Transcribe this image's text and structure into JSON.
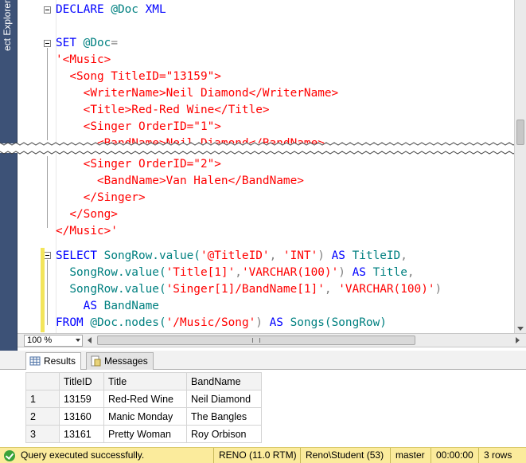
{
  "explorer": {
    "label": "ect Explorer"
  },
  "editor": {
    "lines": [
      [
        {
          "t": "DECLARE ",
          "c": "kw"
        },
        {
          "t": "@Doc ",
          "c": "fn"
        },
        {
          "t": "XML",
          "c": "kw"
        }
      ],
      [],
      [
        {
          "t": "SET ",
          "c": "kw"
        },
        {
          "t": "@Doc",
          "c": "fn"
        },
        {
          "t": "=",
          "c": "gray"
        }
      ],
      [
        {
          "t": "'<Music>",
          "c": "str"
        }
      ],
      [
        {
          "t": "  <Song TitleID=\"13159\">",
          "c": "str"
        }
      ],
      [
        {
          "t": "    <WriterName>Neil Diamond</WriterName>",
          "c": "str"
        }
      ],
      [
        {
          "t": "    <Title>Red-Red Wine</Title>",
          "c": "str"
        }
      ],
      [
        {
          "t": "    <Singer OrderID=\"1\">",
          "c": "str"
        }
      ],
      [
        {
          "t": "      <BandName>Neil Diamond</BandName>",
          "c": "str"
        }
      ],
      [
        {
          "t": "    <Singer OrderID=\"2\">",
          "c": "str"
        }
      ],
      [
        {
          "t": "      <BandName>Van Halen</BandName>",
          "c": "str"
        }
      ],
      [
        {
          "t": "    </Singer>",
          "c": "str"
        }
      ],
      [
        {
          "t": "  </Song>",
          "c": "str"
        }
      ],
      [
        {
          "t": "</Music>'",
          "c": "str"
        }
      ],
      [],
      [
        {
          "t": "SELECT ",
          "c": "kw"
        },
        {
          "t": "SongRow.value(",
          "c": "fn"
        },
        {
          "t": "'@TitleID'",
          "c": "str"
        },
        {
          "t": ", ",
          "c": "gray"
        },
        {
          "t": "'INT'",
          "c": "str"
        },
        {
          "t": ") ",
          "c": "gray"
        },
        {
          "t": "AS ",
          "c": "kw"
        },
        {
          "t": "TitleID",
          "c": "fn"
        },
        {
          "t": ",",
          "c": "gray"
        }
      ],
      [
        {
          "t": "  SongRow.value(",
          "c": "fn"
        },
        {
          "t": "'Title[1]'",
          "c": "str"
        },
        {
          "t": ",",
          "c": "gray"
        },
        {
          "t": "'VARCHAR(100)'",
          "c": "str"
        },
        {
          "t": ") ",
          "c": "gray"
        },
        {
          "t": "AS ",
          "c": "kw"
        },
        {
          "t": "Title",
          "c": "fn"
        },
        {
          "t": ",",
          "c": "gray"
        }
      ],
      [
        {
          "t": "  SongRow.value(",
          "c": "fn"
        },
        {
          "t": "'Singer[1]/BandName[1]'",
          "c": "str"
        },
        {
          "t": ", ",
          "c": "gray"
        },
        {
          "t": "'VARCHAR(100)'",
          "c": "str"
        },
        {
          "t": ")",
          "c": "gray"
        }
      ],
      [
        {
          "t": "    AS ",
          "c": "kw"
        },
        {
          "t": "BandName",
          "c": "fn"
        }
      ],
      [
        {
          "t": "FROM ",
          "c": "kw"
        },
        {
          "t": "@Doc.nodes(",
          "c": "fn"
        },
        {
          "t": "'/Music/Song'",
          "c": "str"
        },
        {
          "t": ") ",
          "c": "gray"
        },
        {
          "t": "AS ",
          "c": "kw"
        },
        {
          "t": "Songs(SongRow)",
          "c": "fn"
        }
      ]
    ]
  },
  "zoom": {
    "value": "100 %"
  },
  "tabs": [
    {
      "label": "Results",
      "active": true
    },
    {
      "label": "Messages",
      "active": false
    }
  ],
  "results": {
    "columns": [
      "TitleID",
      "Title",
      "BandName"
    ],
    "rows": [
      {
        "n": "1",
        "cells": [
          "13159",
          "Red-Red Wine",
          "Neil Diamond"
        ]
      },
      {
        "n": "2",
        "cells": [
          "13160",
          "Manic Monday",
          "The Bangles"
        ]
      },
      {
        "n": "3",
        "cells": [
          "13161",
          "Pretty Woman",
          "Roy Orbison"
        ]
      }
    ]
  },
  "status": {
    "message": "Query executed successfully.",
    "server": "RENO (11.0 RTM)",
    "user": "Reno\\Student (53)",
    "database": "master",
    "elapsed": "00:00:00",
    "rows": "3 rows"
  }
}
